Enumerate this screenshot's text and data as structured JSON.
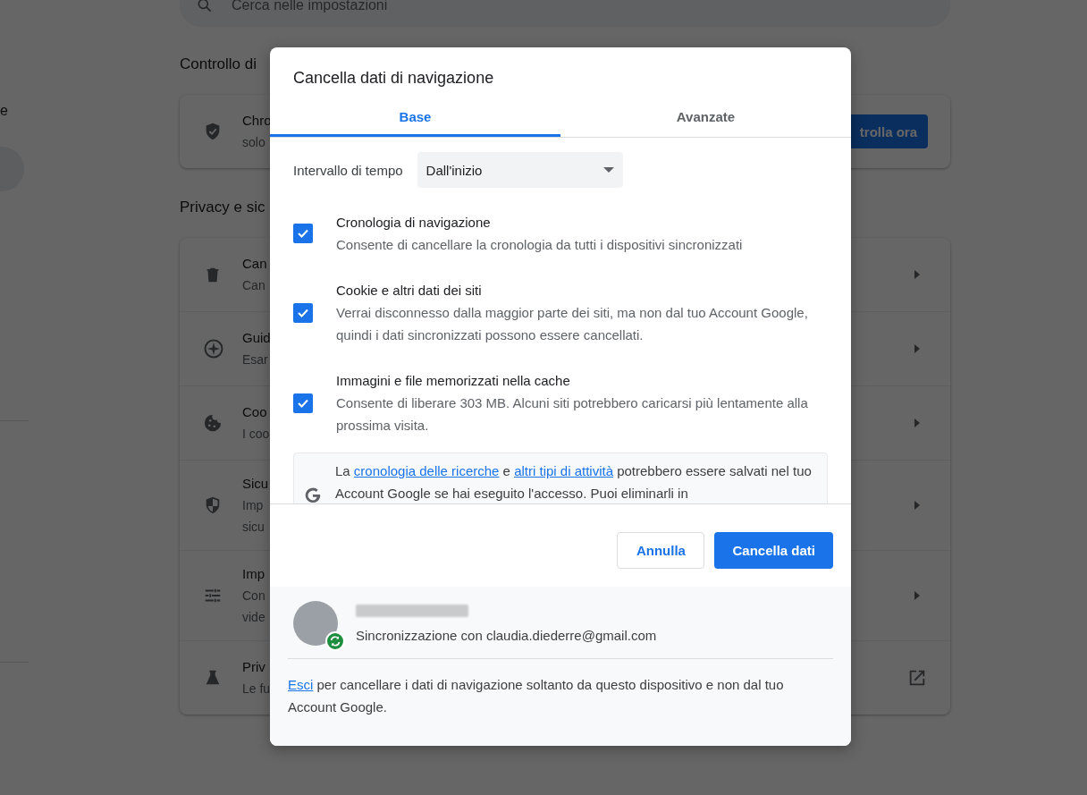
{
  "settings": {
    "search": {
      "placeholder": "Cerca nelle impostazioni"
    },
    "sidebar": {
      "text": "e"
    },
    "sections": [
      {
        "title": "Controllo di",
        "rows": [
          {
            "kind": "action",
            "title": "Chro",
            "lines": [
              "solo"
            ],
            "action": "trolla ora"
          }
        ]
      },
      {
        "title": "Privacy e sic",
        "rows": [
          {
            "kind": "arrow",
            "title": "Can",
            "lines": [
              "Can"
            ]
          },
          {
            "kind": "arrow",
            "title": "Guid",
            "lines": [
              "Esar"
            ]
          },
          {
            "kind": "arrow",
            "title": "Coo",
            "lines": [
              "I coo"
            ]
          },
          {
            "kind": "arrow",
            "title": "Sicu",
            "lines": [
              "Imp",
              "sicu"
            ]
          },
          {
            "kind": "arrow",
            "title": "Imp",
            "lines": [
              "Con",
              "vide"
            ]
          },
          {
            "kind": "external",
            "title": "Priv",
            "lines": [
              "Le fu"
            ]
          }
        ]
      }
    ]
  },
  "dialog": {
    "title": "Cancella dati di navigazione",
    "tabs": [
      {
        "label": "Base",
        "selected": true
      },
      {
        "label": "Avanzate",
        "selected": false
      }
    ],
    "time_range": {
      "label": "Intervallo di tempo",
      "value": "Dall'inizio"
    },
    "items": [
      {
        "title": "Cronologia di navigazione",
        "description": "Consente di cancellare la cronologia da tutti i dispositivi sincronizzati",
        "checked": true
      },
      {
        "title": "Cookie e altri dati dei siti",
        "description": "Verrai disconnesso dalla maggior parte dei siti, ma non dal tuo Account Google, quindi i dati sincronizzati possono essere cancellati.",
        "checked": true
      },
      {
        "title": "Immagini e file memorizzati nella cache",
        "description": "Consente di liberare 303 MB. Alcuni siti potrebbero caricarsi più lentamente alla prossima visita.",
        "checked": true
      }
    ],
    "info": [
      {
        "kind": "text",
        "text": "La "
      },
      {
        "kind": "link",
        "text": "cronologia delle ricerche"
      },
      {
        "kind": "text",
        "text": " e "
      },
      {
        "kind": "link",
        "text": "altri tipi di attività"
      },
      {
        "kind": "text",
        "text": " potrebbero essere salvati nel tuo Account Google se hai eseguito l'accesso. Puoi eliminarli in"
      }
    ],
    "buttons": [
      {
        "kind": "secondary",
        "label": "Annulla"
      },
      {
        "kind": "primary",
        "label": "Cancella dati"
      }
    ],
    "sync": {
      "status": "Sincronizzazione con claudia.diederre@gmail.com"
    },
    "signout": [
      {
        "kind": "link",
        "text": "Esci"
      },
      {
        "kind": "text",
        "text": " per cancellare i dati di navigazione soltanto da questo dispositivo e non dal tuo Account Google."
      }
    ]
  }
}
